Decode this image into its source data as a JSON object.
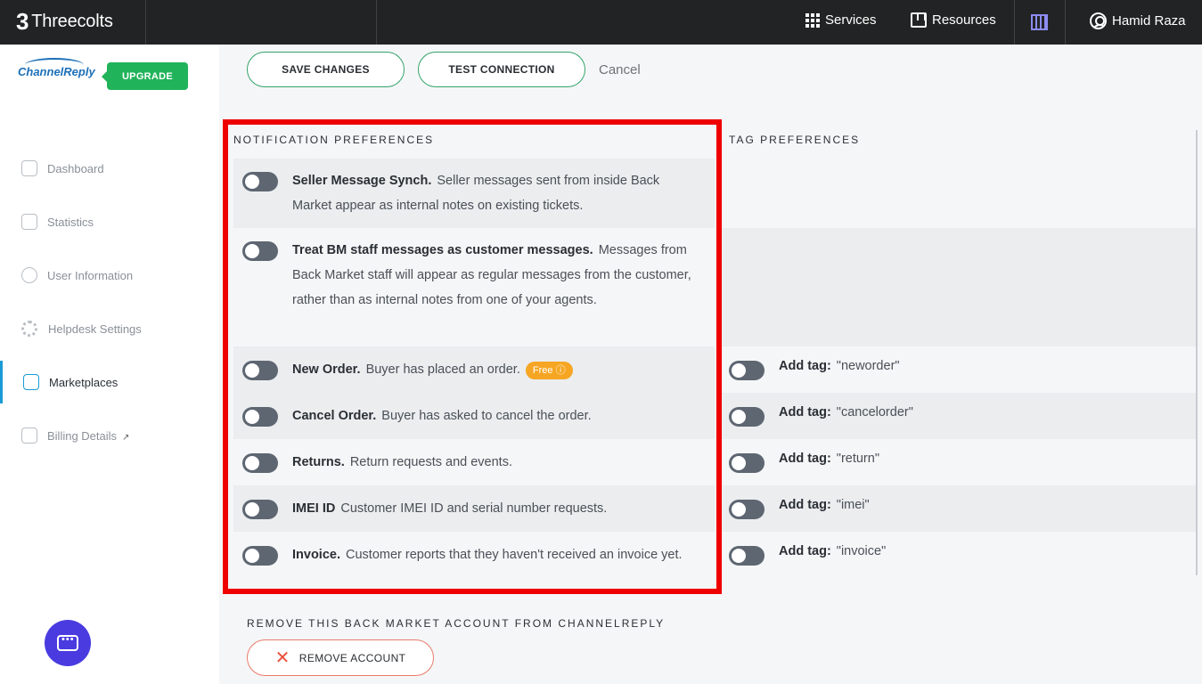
{
  "topbar": {
    "brand": "Threecolts",
    "services_label": "Services",
    "resources_label": "Resources",
    "user_name": "Hamid Raza",
    "icons": {
      "services": "grid-icon",
      "resources": "book-icon",
      "building": "building-icon",
      "user": "user-circle-icon"
    }
  },
  "sidebar": {
    "logo_text": "ChannelReply",
    "upgrade_label": "UPGRADE",
    "items": [
      {
        "label": "Dashboard",
        "icon": "home-icon"
      },
      {
        "label": "Statistics",
        "icon": "clipboard-icon"
      },
      {
        "label": "User Information",
        "icon": "user-icon"
      },
      {
        "label": "Helpdesk Settings",
        "icon": "gear-icon"
      },
      {
        "label": "Marketplaces",
        "icon": "store-icon",
        "active": true
      },
      {
        "label": "Billing Details",
        "icon": "invoice-icon",
        "external": true
      }
    ]
  },
  "actions": {
    "save_label": "SAVE CHANGES",
    "test_label": "TEST CONNECTION",
    "cancel_label": "Cancel"
  },
  "notifications": {
    "heading": "NOTIFICATION PREFERENCES",
    "rows": [
      {
        "title": "Seller Message Synch.",
        "desc": "Seller messages sent from inside Back Market appear as internal notes on existing tickets.",
        "enabled": false
      },
      {
        "title": "Treat BM staff messages as customer messages.",
        "desc": "Messages from Back Market staff will appear as regular messages from the customer, rather than as internal notes from one of your agents.",
        "enabled": false
      },
      {
        "title": "New Order.",
        "desc": "Buyer has placed an order.",
        "badge": "Free",
        "enabled": false
      },
      {
        "title": "Cancel Order.",
        "desc": "Buyer has asked to cancel the order.",
        "enabled": false
      },
      {
        "title": "Returns.",
        "desc": "Return requests and events.",
        "enabled": false
      },
      {
        "title": "IMEI ID",
        "desc": "Customer IMEI ID and serial number requests.",
        "enabled": false
      },
      {
        "title": "Invoice.",
        "desc": "Customer reports that they haven't received an invoice yet.",
        "enabled": false
      }
    ]
  },
  "tags": {
    "heading": "TAG PREFERENCES",
    "label": "Add tag:",
    "rows": [
      {
        "value": "\"neworder\"",
        "enabled": false
      },
      {
        "value": "\"cancelorder\"",
        "enabled": false
      },
      {
        "value": "\"return\"",
        "enabled": false
      },
      {
        "value": "\"imei\"",
        "enabled": false
      },
      {
        "value": "\"invoice\"",
        "enabled": false
      }
    ]
  },
  "remove": {
    "heading": "REMOVE THIS BACK MARKET ACCOUNT FROM CHANNELREPLY",
    "button_label": "REMOVE ACCOUNT"
  },
  "colors": {
    "accent": "#21b35a",
    "highlight": "#ee0000",
    "toggle_off": "#5e6672",
    "chat": "#4a3be0"
  }
}
